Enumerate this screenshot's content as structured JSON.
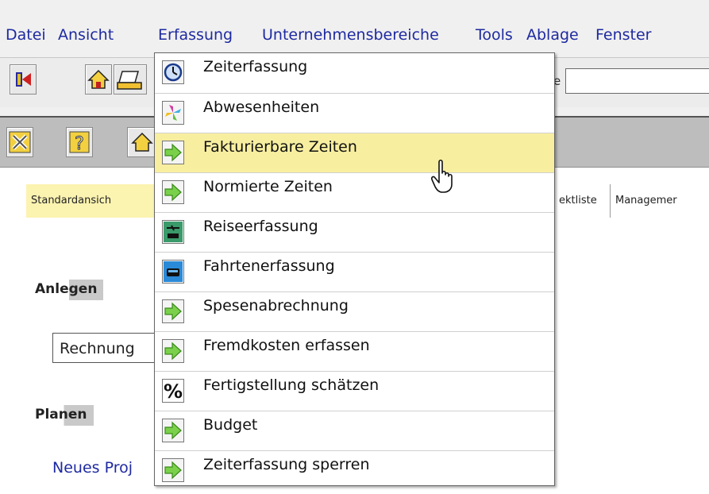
{
  "menubar": {
    "items": [
      "Datei",
      "Ansicht",
      "Erfassung",
      "Unternehmensbereiche",
      "Tools",
      "Ablage",
      "Fenster"
    ]
  },
  "inner": {
    "tabs": [
      "Standardansich",
      "ektliste",
      "Managemer"
    ],
    "section_anlegen": "Anlegen",
    "combo_value": "Rechnung",
    "section_planen": "Planen",
    "link_new_project": "Neues Proj"
  },
  "dropdown": {
    "items": [
      {
        "label": "Zeiterfassung",
        "icon": "clock-icon"
      },
      {
        "label": "Abwesenheiten",
        "icon": "pinwheel-icon"
      },
      {
        "label": "Fakturierbare Zeiten",
        "icon": "green-arrow-icon"
      },
      {
        "label": "Normierte Zeiten",
        "icon": "green-arrow-icon"
      },
      {
        "label": "Reiseerfassung",
        "icon": "travel-icon"
      },
      {
        "label": "Fahrtenerfassung",
        "icon": "car-icon"
      },
      {
        "label": "Spesenabrechnung",
        "icon": "green-arrow-icon"
      },
      {
        "label": "Fremdkosten erfassen",
        "icon": "green-arrow-icon"
      },
      {
        "label": "Fertigstellung schätzen",
        "icon": "percent-icon"
      },
      {
        "label": "Budget",
        "icon": "green-arrow-icon"
      },
      {
        "label": "Zeiterfassung sperren",
        "icon": "green-arrow-icon"
      }
    ],
    "hovered_index": 2,
    "highlight_color": "#f8eea0"
  },
  "colors": {
    "menu_text": "#1e2aa0",
    "active_tab": "#fbf3b0"
  }
}
